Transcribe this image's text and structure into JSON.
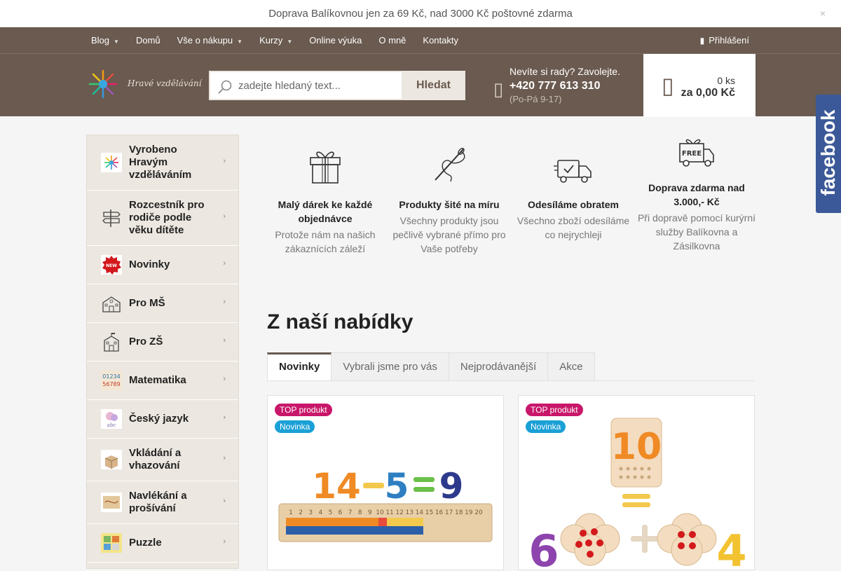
{
  "topbar": {
    "text": "Doprava Balíkovnou jen za 69 Kč, nad 3000 Kč poštovné zdarma",
    "close_icon": "×"
  },
  "nav": {
    "items": [
      {
        "label": "Blog",
        "dropdown": true
      },
      {
        "label": "Domů",
        "dropdown": false
      },
      {
        "label": "Vše o nákupu",
        "dropdown": true
      },
      {
        "label": "Kurzy",
        "dropdown": true
      },
      {
        "label": "Online výuka",
        "dropdown": false
      },
      {
        "label": "O mně",
        "dropdown": false
      },
      {
        "label": "Kontakty",
        "dropdown": false
      }
    ],
    "login": "Přihlášení"
  },
  "header": {
    "logo_text": "Hravé vzdělávání",
    "search_placeholder": "zadejte hledaný text...",
    "search_button": "Hledat",
    "contact_question": "Nevíte si rady? Zavolejte.",
    "phone": "+420 777 613 310",
    "hours": "(Po-Pá 9-17)",
    "cart_count": "0 ks",
    "cart_total": "za 0,00 Kč"
  },
  "facebook": "facebook",
  "categories": [
    {
      "label": "Vyrobeno Hravým vzděláváním",
      "icon": "logo-icon"
    },
    {
      "label": "Rozcestník pro rodiče podle věku dítěte",
      "icon": "signpost-icon"
    },
    {
      "label": "Novinky",
      "icon": "new-badge-icon"
    },
    {
      "label": "Pro MŠ",
      "icon": "school-icon"
    },
    {
      "label": "Pro ZŠ",
      "icon": "school-building-icon"
    },
    {
      "label": "Matematika",
      "icon": "numbers-icon"
    },
    {
      "label": "Český jazyk",
      "icon": "letters-icon"
    },
    {
      "label": "Vkládání a vhazování",
      "icon": "box-icon"
    },
    {
      "label": "Navlékání a prošívání",
      "icon": "lacing-icon"
    },
    {
      "label": "Puzzle",
      "icon": "puzzle-icon"
    }
  ],
  "benefits": [
    {
      "title": "Malý dárek ke každé objednávce",
      "desc": "Protože nám na našich zákaznících záleží",
      "icon": "gift-icon"
    },
    {
      "title": "Produkty šité na míru",
      "desc": "Všechny produkty jsou pečlivě vybrané přímo pro Vaše potřeby",
      "icon": "needle-icon"
    },
    {
      "title": "Odesíláme obratem",
      "desc": "Všechno zboží odesíláme co nejrychleji",
      "icon": "truck-check-icon"
    },
    {
      "title": "Doprava zdarma nad 3.000,- Kč",
      "desc": "Při dopravě pomocí kurýrní služby Balíkovna a Zásilkovna",
      "icon": "free-delivery-icon"
    }
  ],
  "section_title": "Z naší nabídky",
  "tabs": [
    {
      "label": "Novinky",
      "active": true
    },
    {
      "label": "Vybrali jsme pro vás",
      "active": false
    },
    {
      "label": "Nejprodávanější",
      "active": false
    },
    {
      "label": "Akce",
      "active": false
    }
  ],
  "products": [
    {
      "badge_top": "TOP produkt",
      "badge_new": "Novinka",
      "image": "counting-board-image",
      "equation": [
        "14",
        "5",
        "9"
      ],
      "ruler": [
        "1",
        "2",
        "3",
        "4",
        "5",
        "6",
        "7",
        "8",
        "9",
        "10",
        "11",
        "12",
        "13",
        "14",
        "15",
        "16",
        "17",
        "18",
        "19",
        "20"
      ]
    },
    {
      "badge_top": "TOP produkt",
      "badge_new": "Novinka",
      "image": "flower-counting-image",
      "equation": [
        "10",
        "6",
        "4"
      ]
    }
  ],
  "colors": {
    "brown": "#6a5a4f",
    "beige": "#ece7e0",
    "badge_top": "#c8176a",
    "badge_new": "#1aa0d6",
    "facebook": "#3b5998"
  }
}
